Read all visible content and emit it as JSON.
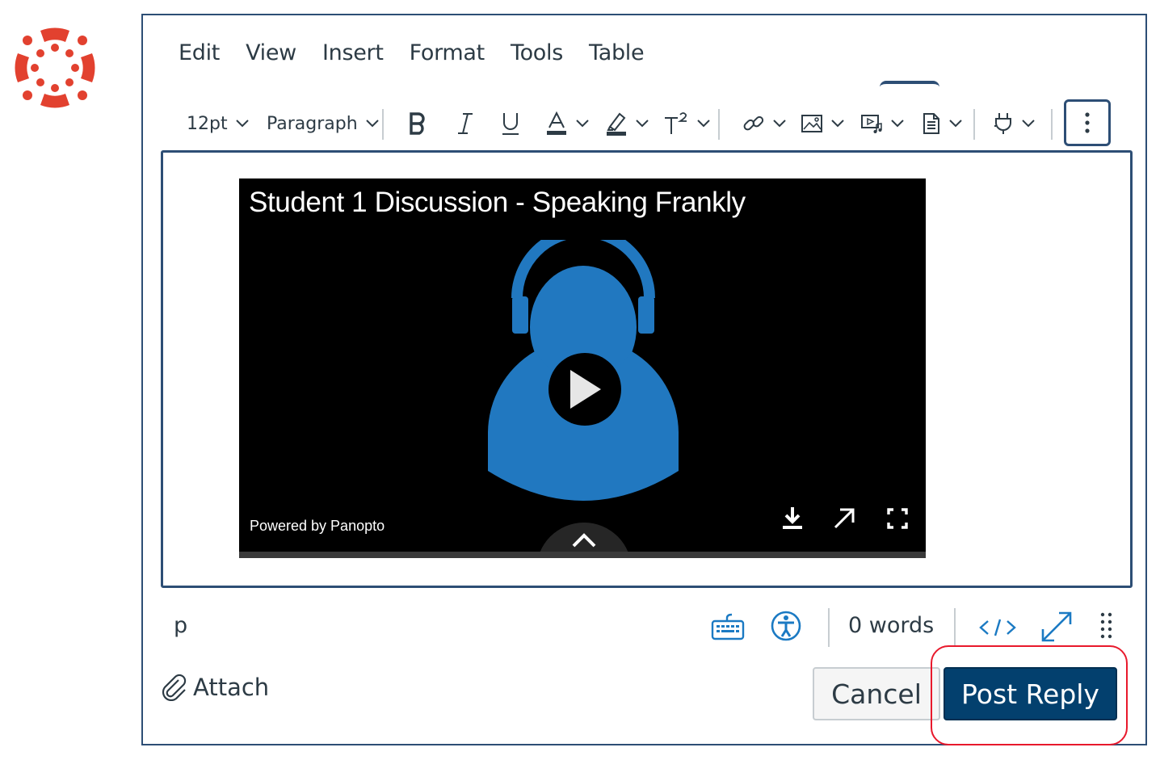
{
  "menubar": {
    "items": [
      "Edit",
      "View",
      "Insert",
      "Format",
      "Tools",
      "Table"
    ]
  },
  "toolbar": {
    "font_size": "12pt",
    "block_format": "Paragraph",
    "icons": [
      "bold-icon",
      "italic-icon",
      "underline-icon",
      "text-color-icon",
      "highlight-icon",
      "superscript-icon",
      "link-icon",
      "image-icon",
      "media-icon",
      "document-icon",
      "plug-icon",
      "more-options-icon"
    ]
  },
  "video": {
    "title": "Student 1  Discussion - Speaking Frankly",
    "powered_by": "Powered by Panopto"
  },
  "statusbar": {
    "path": "p",
    "word_count": "0 words"
  },
  "actions": {
    "attach_label": "Attach",
    "cancel_label": "Cancel",
    "post_label": "Post Reply"
  },
  "colors": {
    "canvas_red": "#e2412f",
    "frame_blue": "#2d4e75",
    "post_button": "#03406e",
    "video_avatar": "#2178c0",
    "link_blue": "#1b7ac3",
    "highlight_red": "#e8192c"
  }
}
